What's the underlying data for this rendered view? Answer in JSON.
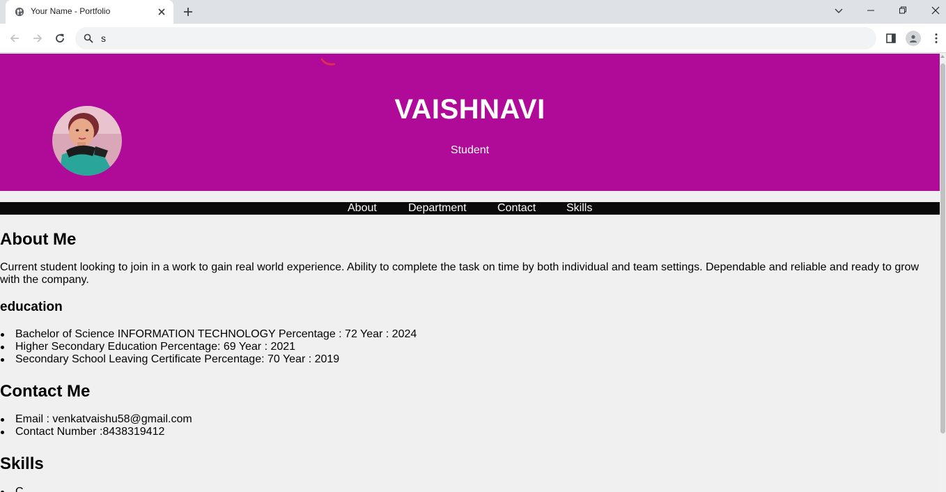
{
  "browser": {
    "tab_title": "Your Name - Portfolio",
    "address_text": "s",
    "icons": [
      "globe-icon",
      "close-icon",
      "plus-icon",
      "chevron-down-icon",
      "minimize-icon",
      "restore-icon",
      "close-window-icon",
      "back-arrow-icon",
      "forward-arrow-icon",
      "reload-icon",
      "search-icon",
      "side-panel-icon",
      "profile-icon",
      "kebab-menu-icon"
    ]
  },
  "page": {
    "colors": {
      "hero_bg": "#b00b98",
      "nav_bg": "#0a0a0a",
      "page_bg": "#f0f0f0",
      "spinner": "#e0304a"
    },
    "hero": {
      "name": "VAISHNAVI",
      "role": "Student"
    },
    "nav": {
      "about": "About",
      "department": "Department",
      "contact": "Contact",
      "skills": "Skills"
    },
    "about": {
      "heading": "About Me",
      "text": "Current student looking to join in a work to gain real world experience. Ability to complete the task on time by both individual and team settings. Dependable and reliable and ready to grow with the company."
    },
    "education": {
      "heading": "education",
      "items": [
        "Bachelor of Science INFORMATION TECHNOLOGY Percentage : 72 Year : 2024",
        "Higher Secondary Education Percentage: 69 Year : 2021",
        "Secondary School Leaving Certificate Percentage: 70 Year : 2019"
      ]
    },
    "contact": {
      "heading": "Contact Me",
      "items": [
        "Email : venkatvaishu58@gmail.com",
        "Contact Number :8438319412"
      ]
    },
    "skills": {
      "heading": "Skills",
      "items": [
        "C"
      ]
    }
  }
}
